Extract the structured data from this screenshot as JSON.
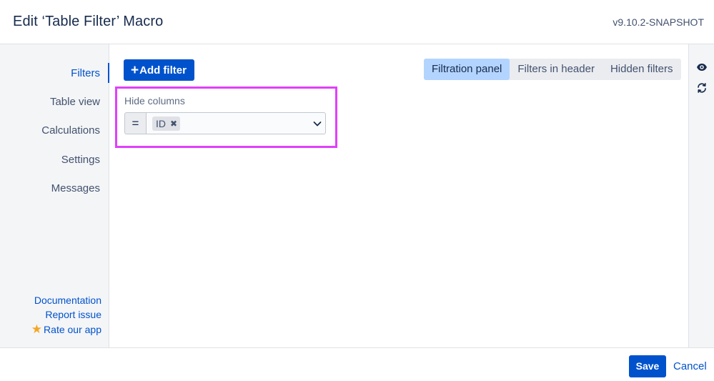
{
  "header": {
    "title": "Edit ‘Table Filter’ Macro",
    "version": "v9.10.2-SNAPSHOT"
  },
  "sidebar": {
    "items": [
      {
        "label": "Filters",
        "active": true
      },
      {
        "label": "Table view",
        "active": false
      },
      {
        "label": "Calculations",
        "active": false
      },
      {
        "label": "Settings",
        "active": false
      },
      {
        "label": "Messages",
        "active": false
      }
    ],
    "links": {
      "documentation": "Documentation",
      "report_issue": "Report issue",
      "rate_app": "Rate our app",
      "rate_icon": "star-icon"
    }
  },
  "main": {
    "add_filter_plus": "+",
    "add_filter_label": "Add filter",
    "tabs": [
      {
        "label": "Filtration panel",
        "active": true
      },
      {
        "label": "Filters in header",
        "active": false
      },
      {
        "label": "Hidden filters",
        "active": false
      }
    ],
    "filter": {
      "label": "Hide columns",
      "operator": "=",
      "chips": [
        "ID"
      ],
      "chip_remove_glyph": "✖"
    }
  },
  "rightbar": {
    "icons": [
      "eye-icon",
      "refresh-icon"
    ]
  },
  "footer": {
    "save_label": "Save",
    "cancel_label": "Cancel"
  },
  "colors": {
    "primary": "#0052cc",
    "highlight_border": "#e040fb",
    "active_tab": "#b3d4ff",
    "sidebar_bg": "#f4f5f7",
    "star": "#f5a623"
  }
}
